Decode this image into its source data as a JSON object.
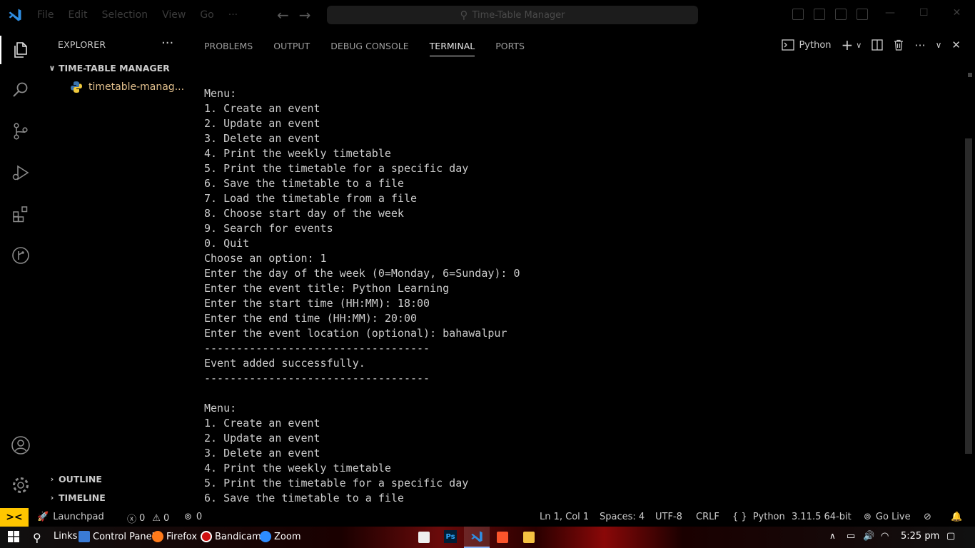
{
  "titlebar": {
    "menu": [
      "File",
      "Edit",
      "Selection",
      "View",
      "Go",
      "···"
    ],
    "command_center": "Time-Table Manager"
  },
  "explorer": {
    "header": "EXPLORER",
    "more": "···",
    "folder": "TIME-TABLE MANAGER",
    "file": "timetable-manag...",
    "outline": "OUTLINE",
    "timeline": "TIMELINE"
  },
  "panel": {
    "tabs": [
      "PROBLEMS",
      "OUTPUT",
      "DEBUG CONSOLE",
      "TERMINAL",
      "PORTS"
    ],
    "active_tab": "TERMINAL",
    "terminal_profile": "Python",
    "lines": [
      "Menu:",
      "1. Create an event",
      "2. Update an event",
      "3. Delete an event",
      "4. Print the weekly timetable",
      "5. Print the timetable for a specific day",
      "6. Save the timetable to a file",
      "7. Load the timetable from a file",
      "8. Choose start day of the week",
      "9. Search for events",
      "0. Quit",
      "Choose an option: 1",
      "Enter the day of the week (0=Monday, 6=Sunday): 0",
      "Enter the event title: Python Learning",
      "Enter the start time (HH:MM): 18:00",
      "Enter the end time (HH:MM): 20:00",
      "Enter the event location (optional): bahawalpur",
      "-----------------------------------",
      "Event added successfully.",
      "-----------------------------------",
      "",
      "Menu:",
      "1. Create an event",
      "2. Update an event",
      "3. Delete an event",
      "4. Print the weekly timetable",
      "5. Print the timetable for a specific day",
      "6. Save the timetable to a file"
    ]
  },
  "statusbar": {
    "remote": "><",
    "launchpad": "Launchpad",
    "errors": "0",
    "warnings": "0",
    "ports": "0",
    "position": "Ln 1, Col 1",
    "spaces": "Spaces: 4",
    "encoding": "UTF-8",
    "eol": "CRLF",
    "language": "Python",
    "interpreter": "3.11.5 64-bit",
    "golive": "Go Live"
  },
  "taskbar": {
    "links": "Links",
    "control_panel": "Control Panel",
    "firefox": "Firefox",
    "bandicam": "Bandicam",
    "zoom": "Zoom",
    "ps_label": "Ps",
    "time": "5:25 pm"
  },
  "colors": {
    "accent_yellow": "#ffc600",
    "vscode_blue": "#2f8fe4",
    "file_yellow": "#e2c08d"
  }
}
